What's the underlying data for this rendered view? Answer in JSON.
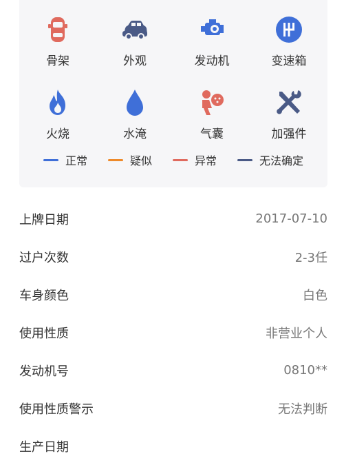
{
  "inspection": {
    "items": [
      {
        "label": "骨架",
        "icon": "car-frame-icon",
        "color": "#e06a5e"
      },
      {
        "label": "外观",
        "icon": "car-exterior-icon",
        "color": "#4a5a86"
      },
      {
        "label": "发动机",
        "icon": "engine-icon",
        "color": "#3f6fd8"
      },
      {
        "label": "变速箱",
        "icon": "gearbox-icon",
        "color": "#3f6fd8"
      },
      {
        "label": "火烧",
        "icon": "fire-icon",
        "color": "#3f6fd8"
      },
      {
        "label": "水淹",
        "icon": "water-drop-icon",
        "color": "#3f6fd8"
      },
      {
        "label": "气囊",
        "icon": "airbag-icon",
        "color": "#e06a5e"
      },
      {
        "label": "加强件",
        "icon": "tools-icon",
        "color": "#4a5a86"
      }
    ],
    "legend": [
      {
        "label": "正常",
        "color": "#3f6fd8"
      },
      {
        "label": "疑似",
        "color": "#ee8a2a"
      },
      {
        "label": "异常",
        "color": "#e06a5e"
      },
      {
        "label": "无法确定",
        "color": "#4a5a86"
      }
    ]
  },
  "details": [
    {
      "label": "上牌日期",
      "value": "2017-07-10"
    },
    {
      "label": "过户次数",
      "value": "2-3任"
    },
    {
      "label": "车身颜色",
      "value": "白色"
    },
    {
      "label": "使用性质",
      "value": "非营业个人"
    },
    {
      "label": "发动机号",
      "value": "0810**"
    },
    {
      "label": "使用性质警示",
      "value": "无法判断"
    },
    {
      "label": "生产日期",
      "value": ""
    }
  ]
}
